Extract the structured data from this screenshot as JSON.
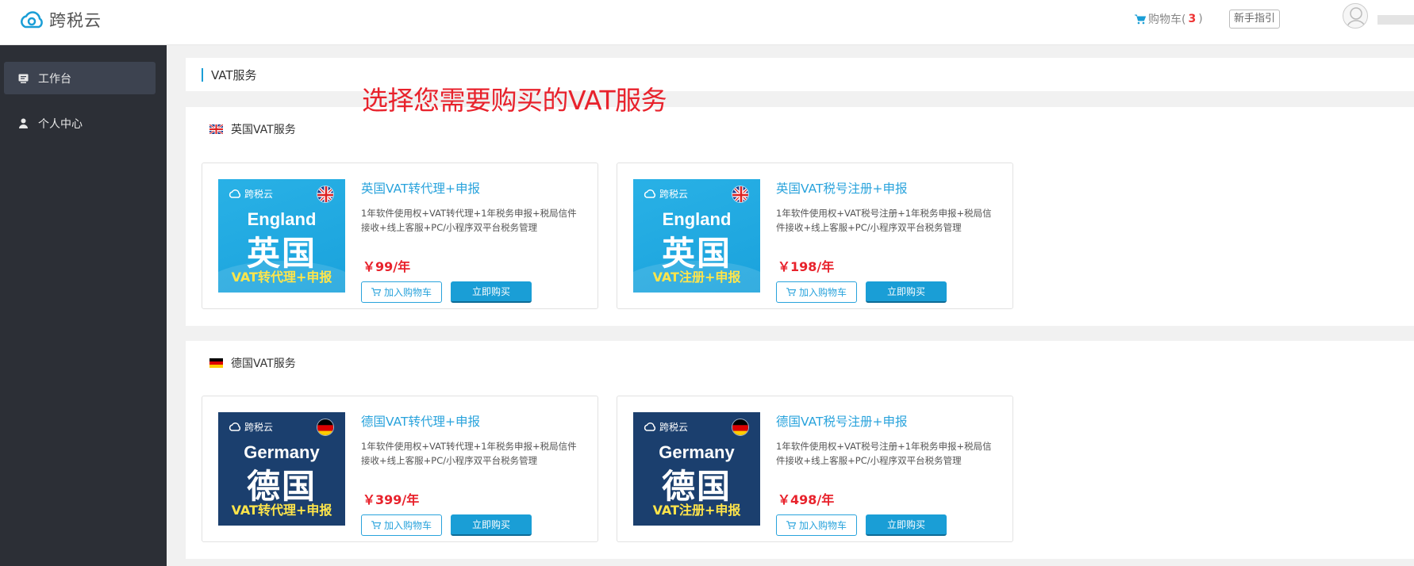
{
  "header": {
    "logo_text": "跨税云",
    "cart_label": "购物车(",
    "cart_count": "3",
    "cart_close": ")",
    "guide_label": "新手指引"
  },
  "sidebar": {
    "items": [
      {
        "label": "工作台",
        "icon": "workbench-icon",
        "active": true
      },
      {
        "label": "个人中心",
        "icon": "user-icon",
        "active": false
      }
    ]
  },
  "page": {
    "title": "VAT服务",
    "banner": "选择您需要购买的VAT服务"
  },
  "sections": [
    {
      "title": "英国VAT服务",
      "flag": "uk-flag-icon",
      "cards": [
        {
          "title": "英国VAT转代理+申报",
          "desc": "1年软件使用权+VAT转代理+1年税务申报+税局信件接收+线上客服+PC/小程序双平台税务管理",
          "price": "￥99/年",
          "thumb": {
            "logo": "跨税云",
            "country": "England",
            "cn": "英国",
            "service": "VAT转代理+申报"
          },
          "cart_btn": "加入购物车",
          "buy_btn": "立即购买"
        },
        {
          "title": "英国VAT税号注册+申报",
          "desc": "1年软件使用权+VAT税号注册+1年税务申报+税局信件接收+线上客服+PC/小程序双平台税务管理",
          "price": "￥198/年",
          "thumb": {
            "logo": "跨税云",
            "country": "England",
            "cn": "英国",
            "service": "VAT注册+申报"
          },
          "cart_btn": "加入购物车",
          "buy_btn": "立即购买"
        }
      ]
    },
    {
      "title": "德国VAT服务",
      "flag": "de-flag-icon",
      "cards": [
        {
          "title": "德国VAT转代理+申报",
          "desc": "1年软件使用权+VAT转代理+1年税务申报+税局信件接收+线上客服+PC/小程序双平台税务管理",
          "price": "￥399/年",
          "thumb": {
            "logo": "跨税云",
            "country": "Germany",
            "cn": "德国",
            "service": "VAT转代理+申报"
          },
          "cart_btn": "加入购物车",
          "buy_btn": "立即购买"
        },
        {
          "title": "德国VAT税号注册+申报",
          "desc": "1年软件使用权+VAT税号注册+1年税务申报+税局信件接收+线上客服+PC/小程序双平台税务管理",
          "price": "￥498/年",
          "thumb": {
            "logo": "跨税云",
            "country": "Germany",
            "cn": "德国",
            "service": "VAT注册+申报"
          },
          "cart_btn": "加入购物车",
          "buy_btn": "立即购买"
        }
      ]
    }
  ],
  "colors": {
    "accent": "#1a9ed6",
    "price": "#e8222c",
    "sidebar_bg": "#2c2f36",
    "uk_thumb": "#29b1e6",
    "de_thumb": "#1b3f6e"
  }
}
